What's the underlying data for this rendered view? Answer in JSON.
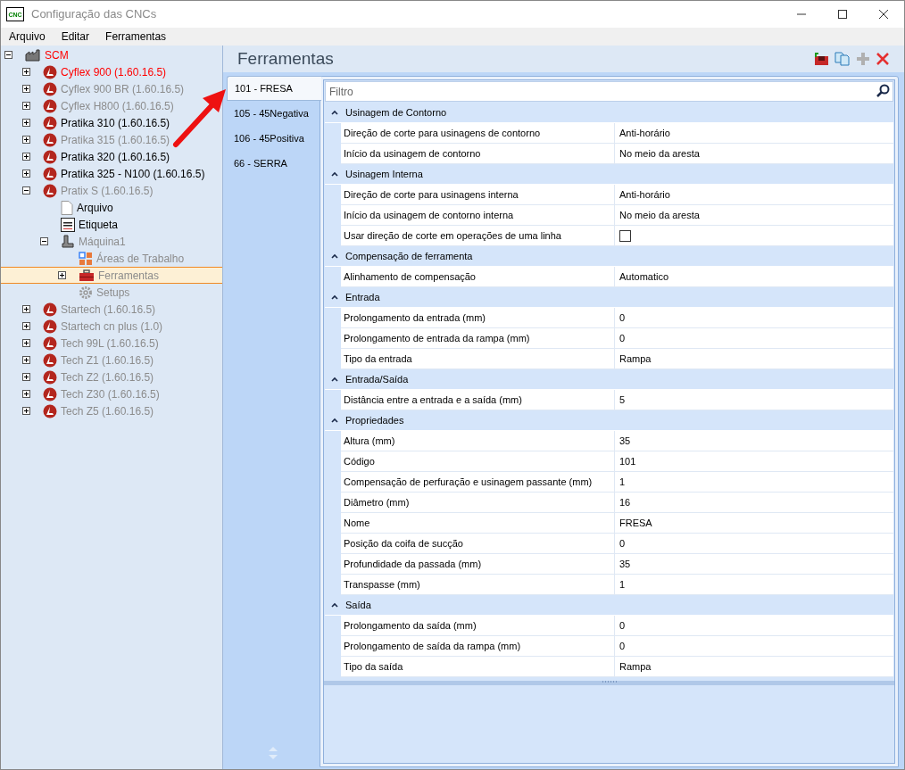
{
  "window": {
    "title": "Configuração das CNCs",
    "icon_text": "CNC"
  },
  "menu": [
    "Arquivo",
    "Editar",
    "Ferramentas"
  ],
  "tree": [
    {
      "label": "SCM",
      "kind": "factory",
      "color": "#ff0000",
      "expanded": true,
      "selected": false,
      "children": [
        {
          "label": "Cyflex 900 (1.60.16.5)",
          "kind": "machine-logo",
          "color": "#ff0000",
          "expanded": false,
          "selected": false
        },
        {
          "label": "Cyflex 900 BR (1.60.16.5)",
          "kind": "machine-logo",
          "color": "#8c8c8c",
          "expanded": false,
          "selected": false
        },
        {
          "label": "Cyflex H800 (1.60.16.5)",
          "kind": "machine-logo",
          "color": "#8c8c8c",
          "expanded": false,
          "selected": false
        },
        {
          "label": "Pratika 310 (1.60.16.5)",
          "kind": "machine-logo",
          "color": "#000000",
          "expanded": false,
          "selected": false
        },
        {
          "label": "Pratika 315 (1.60.16.5)",
          "kind": "machine-logo",
          "color": "#8c8c8c",
          "expanded": false,
          "selected": false
        },
        {
          "label": "Pratika 320 (1.60.16.5)",
          "kind": "machine-logo",
          "color": "#000000",
          "expanded": false,
          "selected": false
        },
        {
          "label": "Pratika 325 - N100 (1.60.16.5)",
          "kind": "machine-logo",
          "color": "#000000",
          "expanded": false,
          "selected": false
        },
        {
          "label": "Pratix S (1.60.16.5)",
          "kind": "machine-logo",
          "color": "#8c8c8c",
          "expanded": true,
          "selected": false,
          "children": [
            {
              "label": "Arquivo",
              "kind": "document",
              "color": "#000000",
              "selected": false
            },
            {
              "label": "Etiqueta",
              "kind": "label",
              "color": "#000000",
              "selected": false
            },
            {
              "label": "Máquina1",
              "kind": "machine",
              "color": "#8c8c8c",
              "expanded": true,
              "selected": false,
              "children": [
                {
                  "label": "Áreas de Trabalho",
                  "kind": "areas",
                  "color": "#8c8c8c",
                  "selected": false
                },
                {
                  "label": "Ferramentas",
                  "kind": "toolbox",
                  "color": "#8c8c8c",
                  "expanded": false,
                  "selected": true
                },
                {
                  "label": "Setups",
                  "kind": "gear",
                  "color": "#8c8c8c",
                  "selected": false
                }
              ]
            }
          ]
        },
        {
          "label": "Startech (1.60.16.5)",
          "kind": "machine-logo",
          "color": "#8c8c8c",
          "expanded": false,
          "selected": false
        },
        {
          "label": "Startech cn plus (1.0)",
          "kind": "machine-logo",
          "color": "#8c8c8c",
          "expanded": false,
          "selected": false
        },
        {
          "label": "Tech 99L (1.60.16.5)",
          "kind": "machine-logo",
          "color": "#8c8c8c",
          "expanded": false,
          "selected": false
        },
        {
          "label": "Tech Z1 (1.60.16.5)",
          "kind": "machine-logo",
          "color": "#8c8c8c",
          "expanded": false,
          "selected": false
        },
        {
          "label": "Tech Z2 (1.60.16.5)",
          "kind": "machine-logo",
          "color": "#8c8c8c",
          "expanded": false,
          "selected": false
        },
        {
          "label": "Tech Z30 (1.60.16.5)",
          "kind": "machine-logo",
          "color": "#8c8c8c",
          "expanded": false,
          "selected": false
        },
        {
          "label": "Tech Z5 (1.60.16.5)",
          "kind": "machine-logo",
          "color": "#8c8c8c",
          "expanded": false,
          "selected": false
        }
      ]
    }
  ],
  "panel": {
    "title": "Ferramentas"
  },
  "tool_tabs": [
    {
      "label": "101 - FRESA",
      "selected": true
    },
    {
      "label": "105 - 45Negativa",
      "selected": false
    },
    {
      "label": "106 - 45Positiva",
      "selected": false
    },
    {
      "label": "66 - SERRA",
      "selected": false
    }
  ],
  "filter": {
    "placeholder": "Filtro"
  },
  "categories": [
    {
      "name": "Usinagem de Contorno",
      "expanded": true,
      "rows": [
        {
          "kind": "text",
          "name": "Direção de corte para usinagens de contorno",
          "value": "Anti-horário"
        },
        {
          "kind": "text",
          "name": "Início da usinagem de contorno",
          "value": "No meio da aresta"
        }
      ]
    },
    {
      "name": "Usinagem Interna",
      "expanded": true,
      "rows": [
        {
          "kind": "text",
          "name": "Direção de corte para usinagens interna",
          "value": "Anti-horário"
        },
        {
          "kind": "text",
          "name": "Início da usinagem de contorno interna",
          "value": "No meio da aresta"
        },
        {
          "kind": "checkbox",
          "name": "Usar direção de corte em operações de uma linha",
          "checked": false
        }
      ]
    },
    {
      "name": "Compensação de ferramenta",
      "expanded": true,
      "rows": [
        {
          "kind": "text",
          "name": "Alinhamento de compensação",
          "value": "Automatico"
        }
      ]
    },
    {
      "name": "Entrada",
      "expanded": true,
      "rows": [
        {
          "kind": "text",
          "name": "Prolongamento da entrada (mm)",
          "value": "0"
        },
        {
          "kind": "text",
          "name": "Prolongamento de entrada da rampa (mm)",
          "value": "0"
        },
        {
          "kind": "text",
          "name": "Tipo da entrada",
          "value": "Rampa"
        }
      ]
    },
    {
      "name": "Entrada/Saída",
      "expanded": true,
      "rows": [
        {
          "kind": "text",
          "name": "Distância entre a entrada e a saída (mm)",
          "value": "5"
        }
      ]
    },
    {
      "name": "Propriedades",
      "expanded": true,
      "rows": [
        {
          "kind": "text",
          "name": "Altura (mm)",
          "value": "35"
        },
        {
          "kind": "text",
          "name": "Código",
          "value": "101"
        },
        {
          "kind": "text",
          "name": "Compensação de perfuração e usinagem passante (mm)",
          "value": "1"
        },
        {
          "kind": "text",
          "name": "Diâmetro (mm)",
          "value": "16"
        },
        {
          "kind": "text",
          "name": "Nome",
          "value": "FRESA"
        },
        {
          "kind": "text",
          "name": "Posição da coifa de sucção",
          "value": "0"
        },
        {
          "kind": "text",
          "name": "Profundidade da passada (mm)",
          "value": "35"
        },
        {
          "kind": "text",
          "name": "Transpasse (mm)",
          "value": "1"
        }
      ]
    },
    {
      "name": "Saída",
      "expanded": true,
      "rows": [
        {
          "kind": "text",
          "name": "Prolongamento da saída (mm)",
          "value": "0"
        },
        {
          "kind": "text",
          "name": "Prolongamento de saída da rampa (mm)",
          "value": "0"
        },
        {
          "kind": "text",
          "name": "Tipo da saída",
          "value": "Rampa"
        }
      ]
    }
  ]
}
